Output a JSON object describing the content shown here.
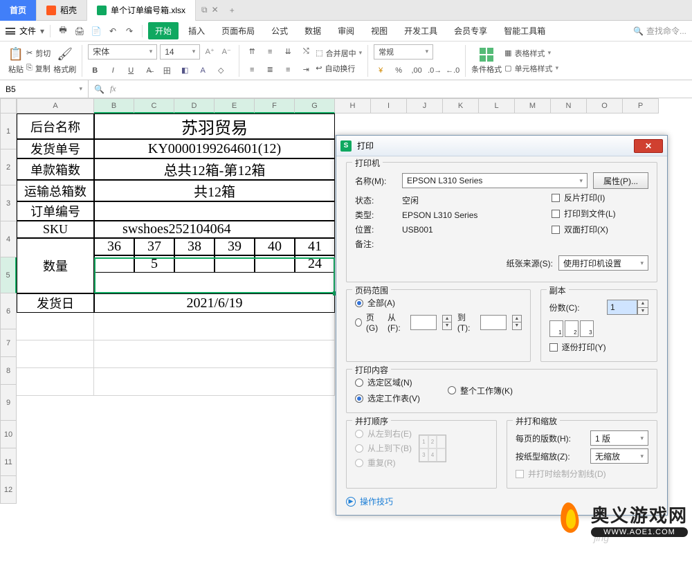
{
  "topbar": {
    "home": "首页",
    "docer": "稻壳",
    "sheet": "单个订单编号箱.xlsx",
    "plus": "+"
  },
  "menu": {
    "file": "文件",
    "tabs": [
      "开始",
      "插入",
      "页面布局",
      "公式",
      "数据",
      "审阅",
      "视图",
      "开发工具",
      "会员专享",
      "智能工具箱"
    ],
    "search": "查找命令..."
  },
  "ribbon": {
    "paste": "粘贴",
    "cut": "剪切",
    "copy": "复制",
    "fmtpaint": "格式刷",
    "font": "宋体",
    "size": "14",
    "merge": "合并居中",
    "wrap": "自动换行",
    "numfmt": "常规",
    "condfmt": "条件格式",
    "tablestyle": "表格样式",
    "cellstyle": "单元格样式"
  },
  "namebox": "B5",
  "cols": [
    "A",
    "B",
    "C",
    "D",
    "E",
    "F",
    "G",
    "H",
    "I",
    "J",
    "K",
    "L",
    "M",
    "N",
    "O",
    "P"
  ],
  "rows": [
    "1",
    "2",
    "3",
    "4",
    "5",
    "6",
    "7",
    "8",
    "9",
    "10",
    "11",
    "12"
  ],
  "table": {
    "labels": {
      "r1": "后台名称",
      "r2": "发货单号",
      "r3": "单款箱数",
      "r4": "运输总箱数",
      "r5": "订单编号",
      "r6": "SKU",
      "r7": "数量",
      "r9": "发货日"
    },
    "vals": {
      "r1": "苏羽贸易",
      "r2": "KY0000199264601(12)",
      "r3": "总共12箱-第12箱",
      "r4": "共12箱",
      "r6": "swshoes252104064",
      "sizes": [
        "36",
        "37",
        "38",
        "39",
        "40",
        "41"
      ],
      "qty": [
        "",
        "5",
        "",
        "",
        "",
        "24"
      ],
      "r9": "2021/6/19"
    }
  },
  "dlg": {
    "title": "打印",
    "printer": "打印机",
    "name": "名称(M):",
    "nameval": "EPSON L310 Series",
    "props": "属性(P)...",
    "status": "状态:",
    "statusval": "空闲",
    "type": "类型:",
    "typeval": "EPSON L310 Series",
    "where": "位置:",
    "whereval": "USB001",
    "comment": "备注:",
    "mirror": "反片打印(I)",
    "tofile": "打印到文件(L)",
    "duplex": "双面打印(X)",
    "papersrc": "纸张来源(S):",
    "papersrcval": "使用打印机设置",
    "range": "页码范围",
    "all": "全部(A)",
    "pages": "页(G)",
    "from": "从(F):",
    "to": "到(T):",
    "copies": "副本",
    "ncopies": "份数(C):",
    "ncopiesval": "1",
    "collate": "逐份打印(Y)",
    "content": "打印内容",
    "selreg": "选定区域(N)",
    "wholewb": "整个工作簿(K)",
    "selsheet": "选定工作表(V)",
    "order": "并打顺序",
    "ltr": "从左到右(E)",
    "ttb": "从上到下(B)",
    "repeat": "重复(R)",
    "scale": "并打和缩放",
    "perpage": "每页的版数(H):",
    "perpageval": "1 版",
    "scaleto": "按纸型缩放(Z):",
    "scaletoval": "无缩放",
    "drawcut": "并打时绘制分割线(D)",
    "tips": "操作技巧"
  },
  "wm": {
    "zh": "奥义游戏网",
    "url": "WWW.AOE1.COM",
    "faint": "jing"
  }
}
